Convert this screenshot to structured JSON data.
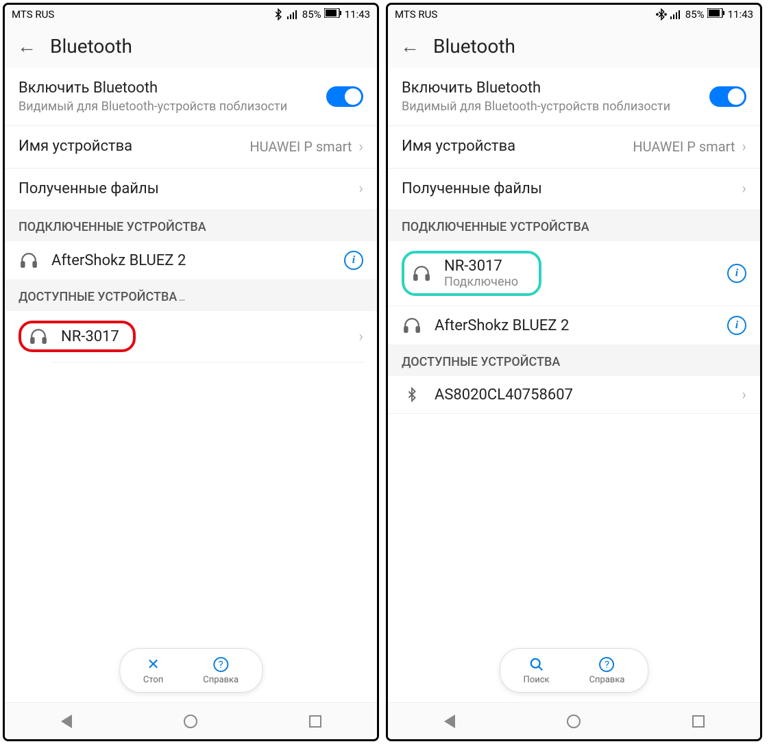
{
  "statusbar": {
    "carrier": "MTS RUS",
    "battery": "85%",
    "time": "11:43"
  },
  "header": {
    "title": "Bluetooth"
  },
  "enable": {
    "title": "Включить Bluetooth",
    "subtitle": "Видимый для Bluetooth-устройств поблизости"
  },
  "device_name_row": {
    "label": "Имя устройства",
    "value": "HUAWEI P smart"
  },
  "received_files": {
    "label": "Полученные файлы"
  },
  "sections": {
    "connected": "ПОДКЛЮЧЕННЫЕ УСТРОЙСТВА",
    "available": "ДОСТУПНЫЕ УСТРОЙСТВА"
  },
  "left": {
    "connected": [
      {
        "name": "AfterShokz BLUEZ 2"
      }
    ],
    "available": [
      {
        "name": "NR-3017"
      }
    ],
    "actions": {
      "stop": "Стоп",
      "help": "Справка"
    }
  },
  "right": {
    "connected": [
      {
        "name": "NR-3017",
        "status": "Подключено"
      },
      {
        "name": "AfterShokz BLUEZ 2"
      }
    ],
    "available": [
      {
        "name": "AS8020CL40758607"
      }
    ],
    "actions": {
      "search": "Поиск",
      "help": "Справка"
    }
  }
}
